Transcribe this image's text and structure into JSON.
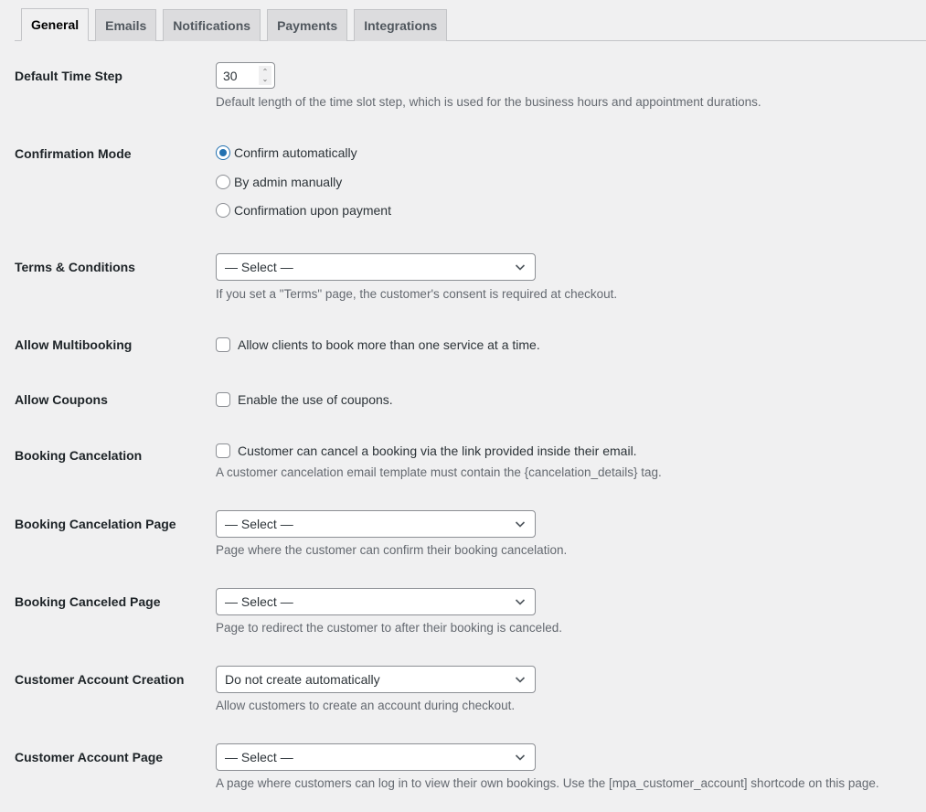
{
  "tabs": [
    {
      "label": "General",
      "active": true
    },
    {
      "label": "Emails",
      "active": false
    },
    {
      "label": "Notifications",
      "active": false
    },
    {
      "label": "Payments",
      "active": false
    },
    {
      "label": "Integrations",
      "active": false
    }
  ],
  "settings": {
    "time_step": {
      "label": "Default Time Step",
      "value": "30",
      "description": "Default length of the time slot step, which is used for the business hours and appointment durations."
    },
    "confirmation_mode": {
      "label": "Confirmation Mode",
      "options": [
        {
          "label": "Confirm automatically",
          "checked": true
        },
        {
          "label": "By admin manually",
          "checked": false
        },
        {
          "label": "Confirmation upon payment",
          "checked": false
        }
      ]
    },
    "terms": {
      "label": "Terms & Conditions",
      "value": "— Select —",
      "description": "If you set a \"Terms\" page, the customer's consent is required at checkout."
    },
    "multibooking": {
      "label": "Allow Multibooking",
      "checkbox_label": "Allow clients to book more than one service at a time.",
      "checked": false
    },
    "coupons": {
      "label": "Allow Coupons",
      "checkbox_label": "Enable the use of coupons.",
      "checked": false
    },
    "cancelation": {
      "label": "Booking Cancelation",
      "checkbox_label": "Customer can cancel a booking via the link provided inside their email.",
      "checked": false,
      "description": "A customer cancelation email template must contain the {cancelation_details} tag."
    },
    "cancelation_page": {
      "label": "Booking Cancelation Page",
      "value": "— Select —",
      "description": "Page where the customer can confirm their booking cancelation."
    },
    "canceled_page": {
      "label": "Booking Canceled Page",
      "value": "— Select —",
      "description": "Page to redirect the customer to after their booking is canceled."
    },
    "account_creation": {
      "label": "Customer Account Creation",
      "value": "Do not create automatically",
      "description": "Allow customers to create an account during checkout."
    },
    "account_page": {
      "label": "Customer Account Page",
      "value": "— Select —",
      "description": "A page where customers can log in to view their own bookings. Use the [mpa_customer_account] shortcode on this page."
    }
  },
  "colors": {
    "accent": "#2271b1",
    "background": "#f0f0f1"
  }
}
